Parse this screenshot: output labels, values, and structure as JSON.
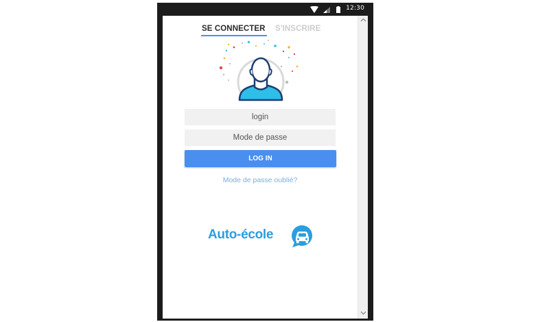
{
  "status_bar": {
    "time": "12:30"
  },
  "tabs": {
    "login": "SE CONNECTER",
    "signup": "S'INSCRIRE"
  },
  "form": {
    "login_placeholder": "login",
    "password_placeholder": "Mode de passe",
    "login_button": "LOG IN",
    "forgot_password": "Mode de passe oublié?"
  },
  "logo": {
    "text": "Auto-école"
  },
  "colors": {
    "accent": "#4a8ef0",
    "link": "#7aaee0",
    "logo": "#2a9ee0",
    "avatar_shirt": "#2ebee8",
    "avatar_outline": "#1c3d6e"
  }
}
